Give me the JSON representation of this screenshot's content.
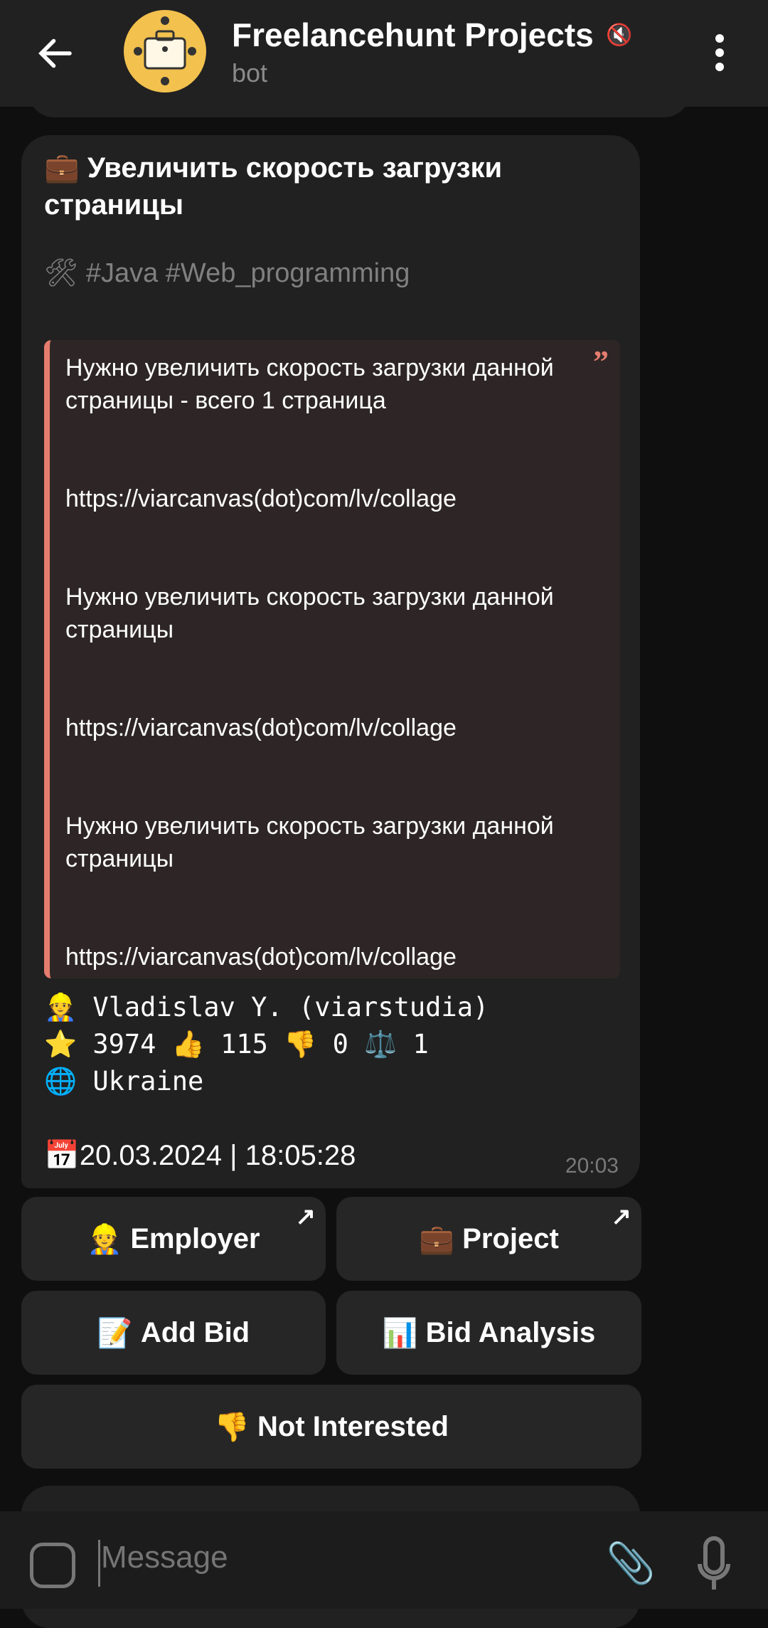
{
  "header": {
    "title": "Freelancehunt Projects",
    "subtitle": "bot",
    "muted_icon": "muted-speaker-icon"
  },
  "message": {
    "title_icon": "💼",
    "title": "Увеличить скорость загрузки страницы",
    "tags_icon": "🛠",
    "tags": "#Java #Web_programming",
    "quote_lines": [
      "Нужно увеличить скорость загрузки данной страницы - всего 1 страница",
      "https://viarcanvas(dot)com/lv/collage",
      "Нужно увеличить скорость загрузки данной страницы",
      "https://viarcanvas(dot)com/lv/collage",
      "Нужно увеличить скорость загрузки данной страницы",
      "https://viarcanvas(dot)com/lv/collage"
    ],
    "employer": {
      "icon": "👷",
      "name": "Vladislav Y. (viarstudia)"
    },
    "stats": {
      "star_icon": "⭐",
      "rating": "3974",
      "up_icon": "👍",
      "positive": "115",
      "down_icon": "👎",
      "negative": "0",
      "scales_icon": "⚖️",
      "arbitrage": "1"
    },
    "country": {
      "icon": "🌐",
      "name": "Ukraine"
    },
    "date": {
      "icon": "📅",
      "value": "20.03.2024 | 18:05:28"
    },
    "time": "20:03"
  },
  "buttons": [
    {
      "icon": "👷",
      "label": "Employer",
      "external": true
    },
    {
      "icon": "💼",
      "label": "Project",
      "external": true
    },
    {
      "icon": "📝",
      "label": "Add Bid"
    },
    {
      "icon": "📊",
      "label": "Bid Analysis"
    },
    {
      "icon": "👎",
      "label": "Not Interested"
    }
  ],
  "external_arrow": "↗",
  "input": {
    "placeholder": "Message"
  },
  "colors": {
    "background": "#0f0f0f",
    "bubble": "#212121",
    "quote_accent": "#e57d6f",
    "quote_bg": "#2e2626"
  }
}
